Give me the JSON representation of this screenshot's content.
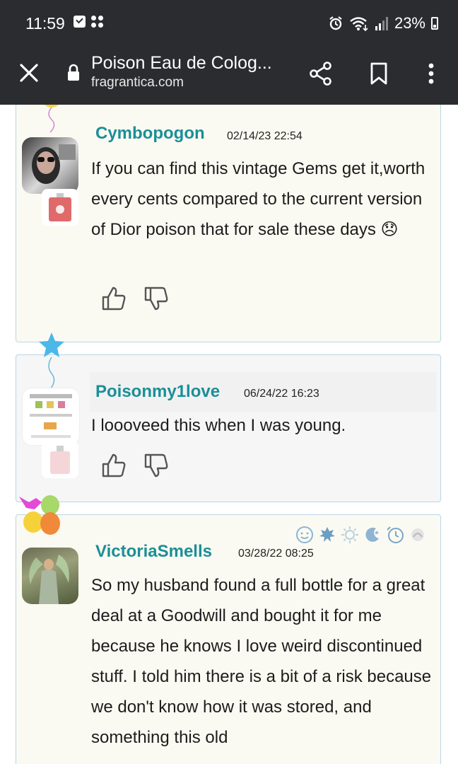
{
  "status_bar": {
    "time": "11:59",
    "battery": "23%"
  },
  "app_bar": {
    "title": "Poison Eau de Colog...",
    "domain": "fragrantica.com",
    "icons": [
      "close-icon",
      "lock-icon",
      "share-icon",
      "bookmark-icon",
      "more-vert-icon"
    ]
  },
  "reviews": [
    {
      "username": "Cymbopogon",
      "date": "02/14/23 22:54",
      "text": "If you can find this vintage Gems get it,worth every cents compared to the current version of Dior poison that for sale these days 😞"
    },
    {
      "username": "Poisonmy1love",
      "date": "06/24/22 16:23",
      "text": "I loooveed this when I was young."
    },
    {
      "username": "VictoriaSmells",
      "date": "03/28/22 08:25",
      "text": "So my husband found a full bottle for a great deal at a Goodwill and bought it for me because he knows I love weird discontinued stuff. I told him there is a bit of a risk because we don't know how it was stored, and something this old",
      "mood_icons": [
        "smile-icon",
        "fall-leaf-icon",
        "sun-icon",
        "night-icon",
        "clock-icon",
        "neutral-icon"
      ]
    }
  ],
  "colors": {
    "bar_bg": "#2b2c30",
    "username": "#1a8f97",
    "card_border": "#b9d6e6"
  }
}
